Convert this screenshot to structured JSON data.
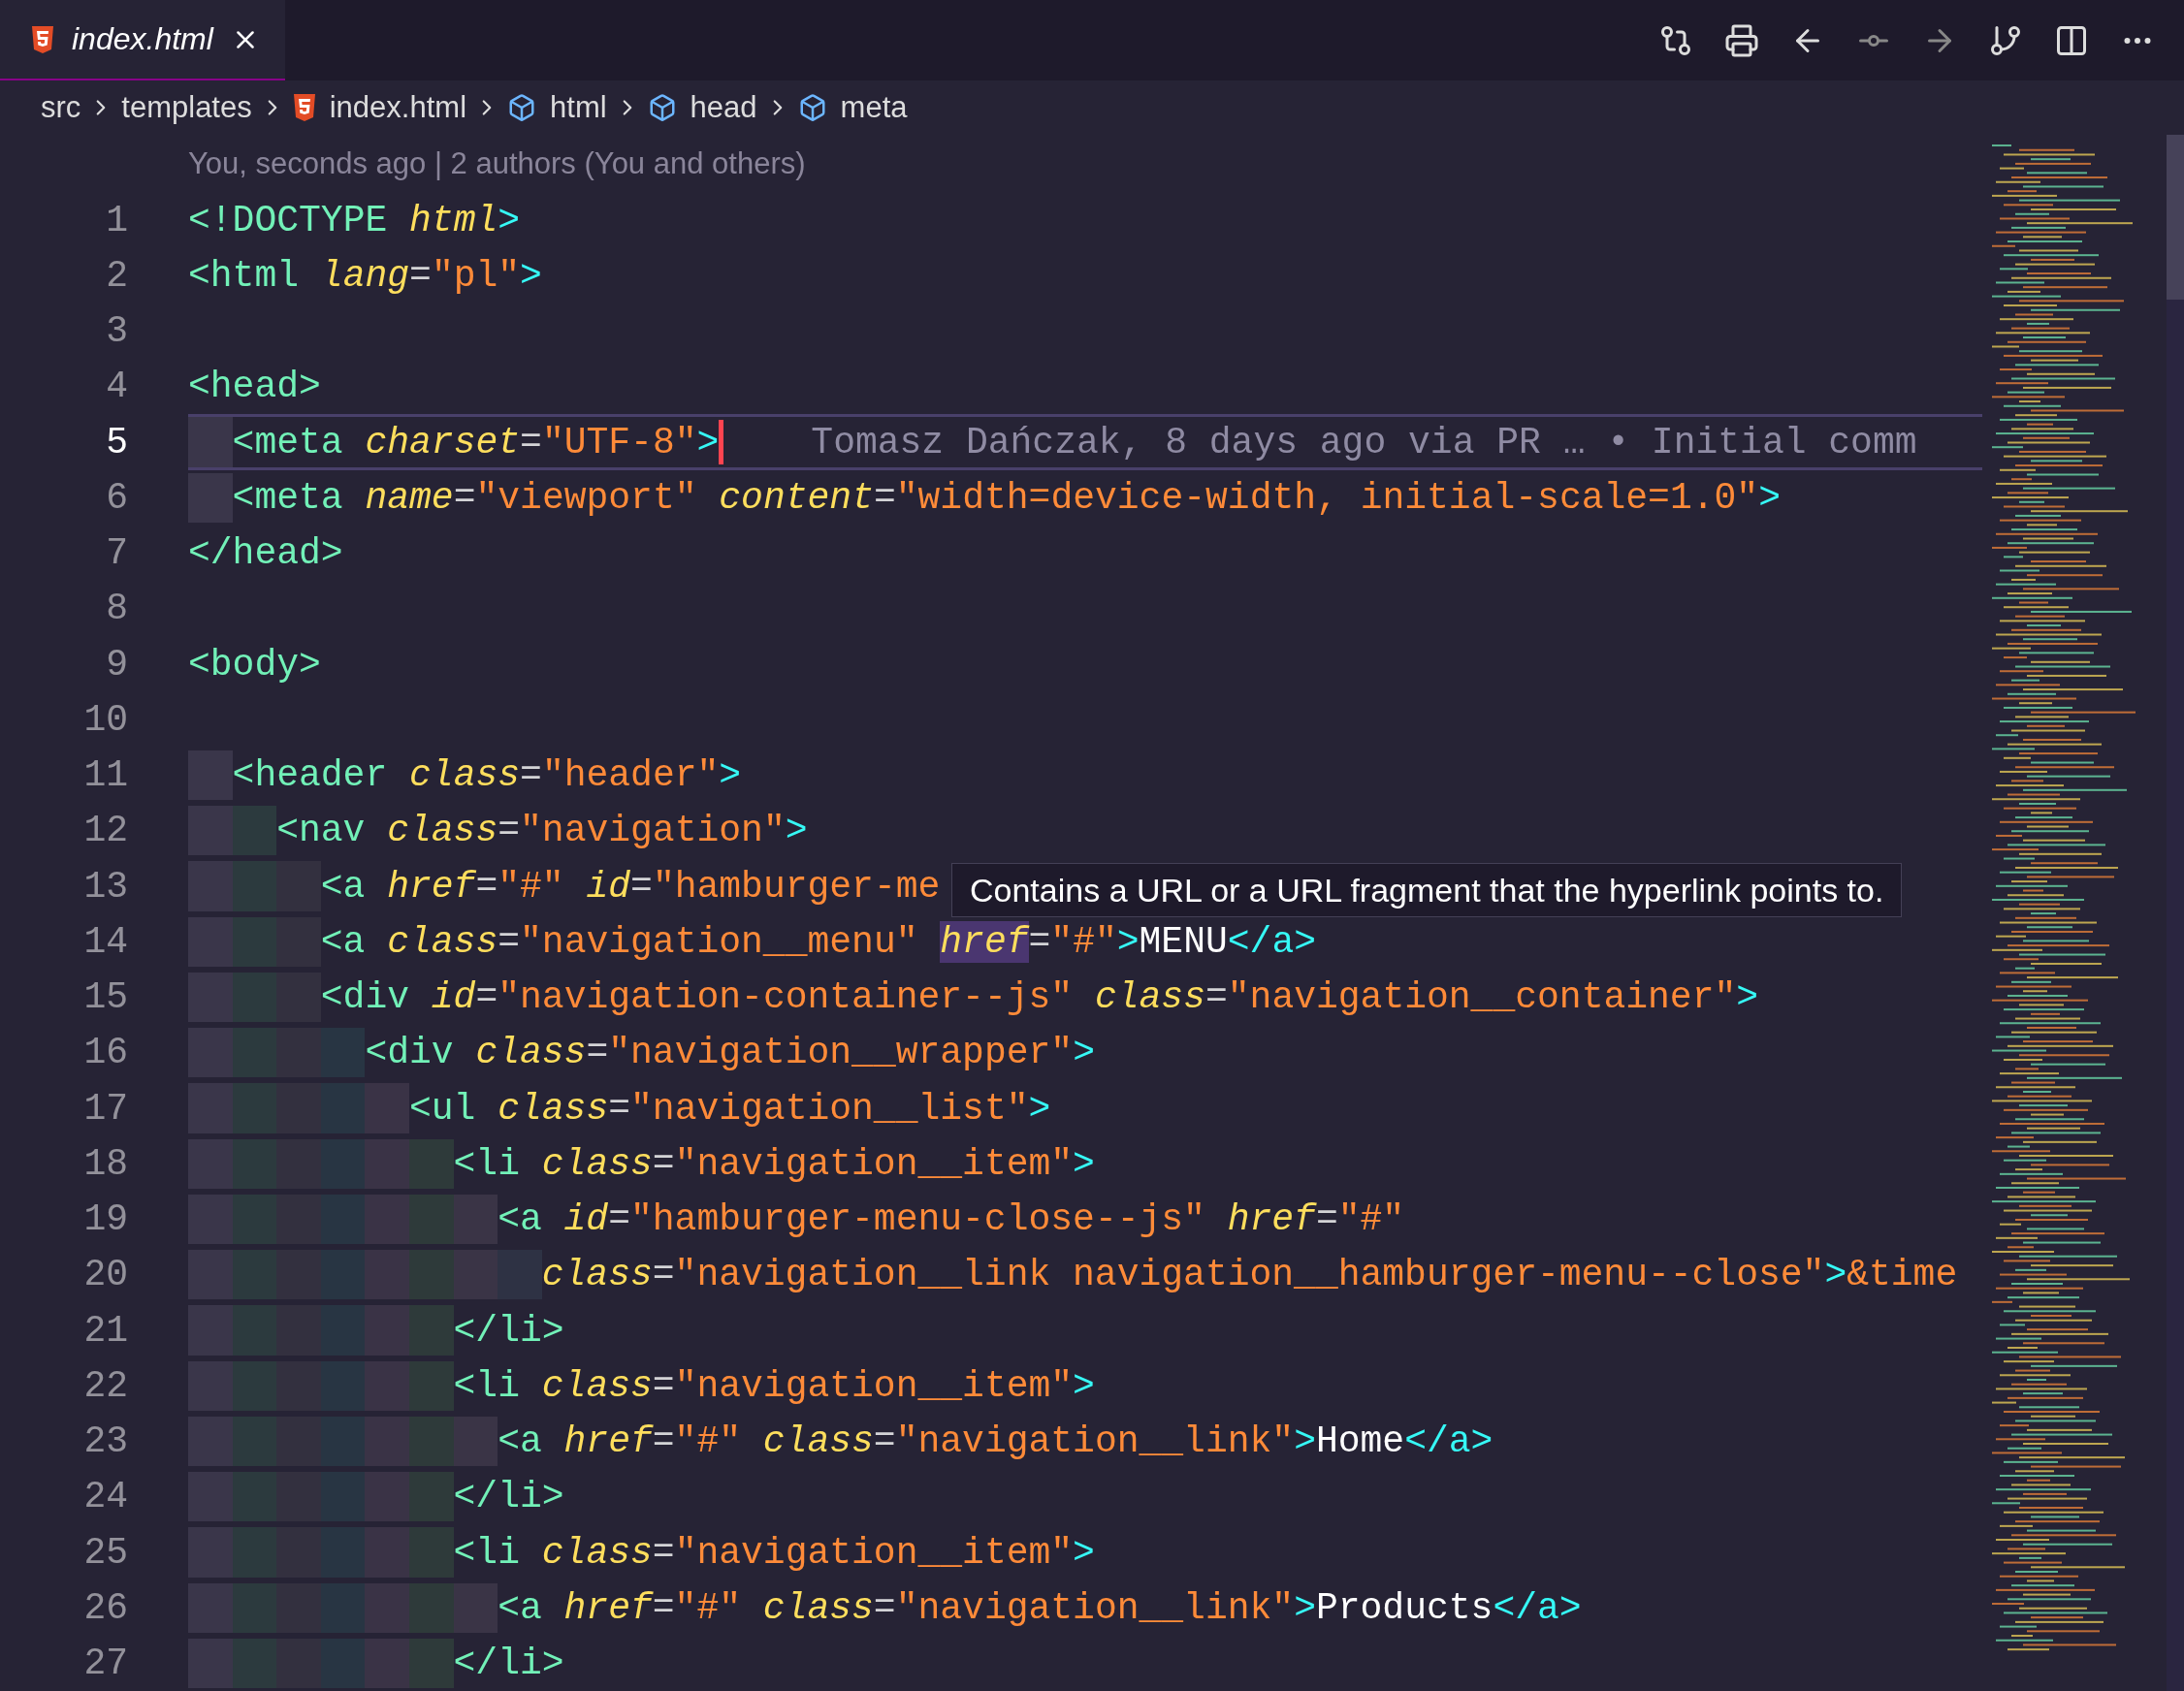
{
  "tabs": [
    {
      "label": "index.html",
      "selected": true
    }
  ],
  "breadcrumbs": [
    {
      "label": "src",
      "kind": "folder"
    },
    {
      "label": "templates",
      "kind": "folder"
    },
    {
      "label": "index.html",
      "kind": "file"
    },
    {
      "label": "html",
      "kind": "element"
    },
    {
      "label": "head",
      "kind": "element"
    },
    {
      "label": "meta",
      "kind": "element"
    }
  ],
  "blame_header": "You, seconds ago | 2 authors (You and others)",
  "lines": [
    {
      "number": "1",
      "current": false,
      "tokens": [
        {
          "kind": "tag",
          "text": "<!DOCTYPE"
        },
        {
          "kind": "attr",
          "text": " html"
        },
        {
          "kind": "bracket",
          "text": ">"
        }
      ]
    },
    {
      "number": "2",
      "current": false,
      "tokens": [
        {
          "kind": "tag",
          "text": "<html"
        },
        {
          "kind": "attr",
          "text": " lang"
        },
        {
          "kind": "punct",
          "text": "="
        },
        {
          "kind": "str",
          "text": "\"pl\""
        },
        {
          "kind": "bracket",
          "text": ">"
        }
      ]
    },
    {
      "number": "3",
      "current": false
    },
    {
      "number": "4",
      "current": false,
      "tokens": [
        {
          "kind": "tag",
          "text": "<head>"
        }
      ],
      "children": [
        {
          "number": "5",
          "current": true,
          "blame": "Tomasz Dańczak, 8 days ago via PR … • Initial comm",
          "tokens": [
            {
              "kind": "tag",
              "text": "<meta"
            },
            {
              "kind": "attr",
              "text": " charset"
            },
            {
              "kind": "punct",
              "text": "="
            },
            {
              "kind": "str",
              "text": "\"UTF-8\""
            },
            {
              "kind": "bracket",
              "text": ">"
            }
          ]
        },
        {
          "number": "6",
          "current": false,
          "tokens": [
            {
              "kind": "tag",
              "text": "<meta"
            },
            {
              "kind": "attr",
              "text": " name"
            },
            {
              "kind": "punct",
              "text": "="
            },
            {
              "kind": "str",
              "text": "\"viewport\""
            },
            {
              "kind": "attr",
              "text": " content"
            },
            {
              "kind": "punct",
              "text": "="
            },
            {
              "kind": "str",
              "text": "\"width=device-width, initial-scale=1.0\""
            },
            {
              "kind": "bracket",
              "text": ">"
            }
          ]
        }
      ]
    },
    {
      "number": "7",
      "current": false,
      "tokens": [
        {
          "kind": "tag",
          "text": "</head>"
        }
      ]
    },
    {
      "number": "8",
      "current": false
    },
    {
      "number": "9",
      "current": false,
      "tokens": [
        {
          "kind": "tag",
          "text": "<body>"
        }
      ],
      "children": [
        {
          "number": "10",
          "current": false
        },
        {
          "number": "11",
          "current": false,
          "tokens": [
            {
              "kind": "tag",
              "text": "<header"
            },
            {
              "kind": "attr",
              "text": " class"
            },
            {
              "kind": "punct",
              "text": "="
            },
            {
              "kind": "str",
              "text": "\"header\""
            },
            {
              "kind": "bracket",
              "text": ">"
            }
          ],
          "children": [
            {
              "number": "12",
              "current": false,
              "tokens": [
                {
                  "kind": "tag",
                  "text": "<nav"
                },
                {
                  "kind": "attr",
                  "text": " class"
                },
                {
                  "kind": "punct",
                  "text": "="
                },
                {
                  "kind": "str",
                  "text": "\"navigation\""
                },
                {
                  "kind": "bracket",
                  "text": ">"
                }
              ],
              "children": [
                {
                  "number": "13",
                  "current": false,
                  "tooltip": "Contains a URL or a URL fragment that the hyperlink points to.",
                  "tokens": [
                    {
                      "kind": "tag",
                      "text": "<a"
                    },
                    {
                      "kind": "attr",
                      "text": " href"
                    },
                    {
                      "kind": "punct",
                      "text": "="
                    },
                    {
                      "kind": "str",
                      "text": "\"#\""
                    },
                    {
                      "kind": "attr",
                      "text": " id"
                    },
                    {
                      "kind": "punct",
                      "text": "="
                    },
                    {
                      "kind": "str",
                      "text": "\"hamburger-me"
                    }
                  ]
                },
                {
                  "number": "14",
                  "current": false,
                  "tokens": [
                    {
                      "kind": "tag",
                      "text": "<a"
                    },
                    {
                      "kind": "attr",
                      "text": " class"
                    },
                    {
                      "kind": "punct",
                      "text": "="
                    },
                    {
                      "kind": "str",
                      "text": "\"navigation__menu\""
                    },
                    {
                      "kind": "hover",
                      "text": "href"
                    },
                    {
                      "kind": "punct",
                      "text": "="
                    },
                    {
                      "kind": "str",
                      "text": "\"#\""
                    },
                    {
                      "kind": "bracket",
                      "text": ">"
                    },
                    {
                      "kind": "text",
                      "text": "MENU"
                    },
                    {
                      "kind": "bracket",
                      "text": "</a>"
                    }
                  ]
                },
                {
                  "number": "15",
                  "current": false,
                  "tokens": [
                    {
                      "kind": "tag",
                      "text": "<div"
                    },
                    {
                      "kind": "attr",
                      "text": " id"
                    },
                    {
                      "kind": "punct",
                      "text": "="
                    },
                    {
                      "kind": "str",
                      "text": "\"navigation-container--js\""
                    },
                    {
                      "kind": "attr",
                      "text": " class"
                    },
                    {
                      "kind": "punct",
                      "text": "="
                    },
                    {
                      "kind": "str",
                      "text": "\"navigation__container\""
                    },
                    {
                      "kind": "bracket",
                      "text": ">"
                    }
                  ],
                  "children": [
                    {
                      "number": "16",
                      "current": false,
                      "tokens": [
                        {
                          "kind": "tag",
                          "text": "<div"
                        },
                        {
                          "kind": "attr",
                          "text": " class"
                        },
                        {
                          "kind": "punct",
                          "text": "="
                        },
                        {
                          "kind": "str",
                          "text": "\"navigation__wrapper\""
                        },
                        {
                          "kind": "bracket",
                          "text": ">"
                        }
                      ],
                      "children": [
                        {
                          "number": "17",
                          "current": false,
                          "tokens": [
                            {
                              "kind": "tag",
                              "text": "<ul"
                            },
                            {
                              "kind": "attr",
                              "text": " class"
                            },
                            {
                              "kind": "punct",
                              "text": "="
                            },
                            {
                              "kind": "str",
                              "text": "\"navigation__list\""
                            },
                            {
                              "kind": "bracket",
                              "text": ">"
                            }
                          ],
                          "children": [
                            {
                              "number": "18",
                              "current": false,
                              "tokens": [
                                {
                                  "kind": "tag",
                                  "text": "<li"
                                },
                                {
                                  "kind": "attr",
                                  "text": " class"
                                },
                                {
                                  "kind": "punct",
                                  "text": "="
                                },
                                {
                                  "kind": "str",
                                  "text": "\"navigation__item\""
                                },
                                {
                                  "kind": "bracket",
                                  "text": ">"
                                }
                              ],
                              "children": [
                                {
                                  "number": "19",
                                  "current": false,
                                  "tokens": [
                                    {
                                      "kind": "tag",
                                      "text": "<a"
                                    },
                                    {
                                      "kind": "attr",
                                      "text": " id"
                                    },
                                    {
                                      "kind": "punct",
                                      "text": "="
                                    },
                                    {
                                      "kind": "str",
                                      "text": "\"hamburger-menu-close--js\""
                                    },
                                    {
                                      "kind": "attr",
                                      "text": " href"
                                    },
                                    {
                                      "kind": "punct",
                                      "text": "="
                                    },
                                    {
                                      "kind": "str",
                                      "text": "\"#\""
                                    }
                                  ],
                                  "children": [
                                    {
                                      "number": "20",
                                      "current": false,
                                      "tokens": [
                                        {
                                          "kind": "attr",
                                          "text": "class"
                                        },
                                        {
                                          "kind": "punct",
                                          "text": "="
                                        },
                                        {
                                          "kind": "str",
                                          "text": "\"navigation__link navigation__hamburger-menu--close\""
                                        },
                                        {
                                          "kind": "bracket",
                                          "text": ">"
                                        },
                                        {
                                          "kind": "entity",
                                          "text": "&time"
                                        }
                                      ]
                                    }
                                  ]
                                }
                              ]
                            },
                            {
                              "number": "21",
                              "current": false,
                              "tokens": [
                                {
                                  "kind": "tag",
                                  "text": "</li>"
                                }
                              ]
                            },
                            {
                              "number": "22",
                              "current": false,
                              "tokens": [
                                {
                                  "kind": "tag",
                                  "text": "<li"
                                },
                                {
                                  "kind": "attr",
                                  "text": " class"
                                },
                                {
                                  "kind": "punct",
                                  "text": "="
                                },
                                {
                                  "kind": "str",
                                  "text": "\"navigation__item\""
                                },
                                {
                                  "kind": "bracket",
                                  "text": ">"
                                }
                              ],
                              "children": [
                                {
                                  "number": "23",
                                  "current": false,
                                  "tokens": [
                                    {
                                      "kind": "tag",
                                      "text": "<a"
                                    },
                                    {
                                      "kind": "attr",
                                      "text": " href"
                                    },
                                    {
                                      "kind": "punct",
                                      "text": "="
                                    },
                                    {
                                      "kind": "str",
                                      "text": "\"#\""
                                    },
                                    {
                                      "kind": "attr",
                                      "text": " class"
                                    },
                                    {
                                      "kind": "punct",
                                      "text": "="
                                    },
                                    {
                                      "kind": "str",
                                      "text": "\"navigation__link\""
                                    },
                                    {
                                      "kind": "bracket",
                                      "text": ">"
                                    },
                                    {
                                      "kind": "text",
                                      "text": "Home"
                                    },
                                    {
                                      "kind": "bracket",
                                      "text": "</a>"
                                    }
                                  ]
                                }
                              ]
                            },
                            {
                              "number": "24",
                              "current": false,
                              "tokens": [
                                {
                                  "kind": "tag",
                                  "text": "</li>"
                                }
                              ]
                            },
                            {
                              "number": "25",
                              "current": false,
                              "tokens": [
                                {
                                  "kind": "tag",
                                  "text": "<li"
                                },
                                {
                                  "kind": "attr",
                                  "text": " class"
                                },
                                {
                                  "kind": "punct",
                                  "text": "="
                                },
                                {
                                  "kind": "str",
                                  "text": "\"navigation__item\""
                                },
                                {
                                  "kind": "bracket",
                                  "text": ">"
                                }
                              ],
                              "children": [
                                {
                                  "number": "26",
                                  "current": false,
                                  "tokens": [
                                    {
                                      "kind": "tag",
                                      "text": "<a"
                                    },
                                    {
                                      "kind": "attr",
                                      "text": " href"
                                    },
                                    {
                                      "kind": "punct",
                                      "text": "="
                                    },
                                    {
                                      "kind": "str",
                                      "text": "\"#\""
                                    },
                                    {
                                      "kind": "attr",
                                      "text": " class"
                                    },
                                    {
                                      "kind": "punct",
                                      "text": "="
                                    },
                                    {
                                      "kind": "str",
                                      "text": "\"navigation__link\""
                                    },
                                    {
                                      "kind": "bracket",
                                      "text": ">"
                                    },
                                    {
                                      "kind": "text",
                                      "text": "Products"
                                    },
                                    {
                                      "kind": "bracket",
                                      "text": "</a>"
                                    }
                                  ]
                                }
                              ]
                            },
                            {
                              "number": "27",
                              "current": false,
                              "tokens": [
                                {
                                  "kind": "tag",
                                  "text": "</li>"
                                }
                              ]
                            }
                          ]
                        }
                      ]
                    }
                  ]
                }
              ]
            }
          ]
        }
      ]
    }
  ]
}
